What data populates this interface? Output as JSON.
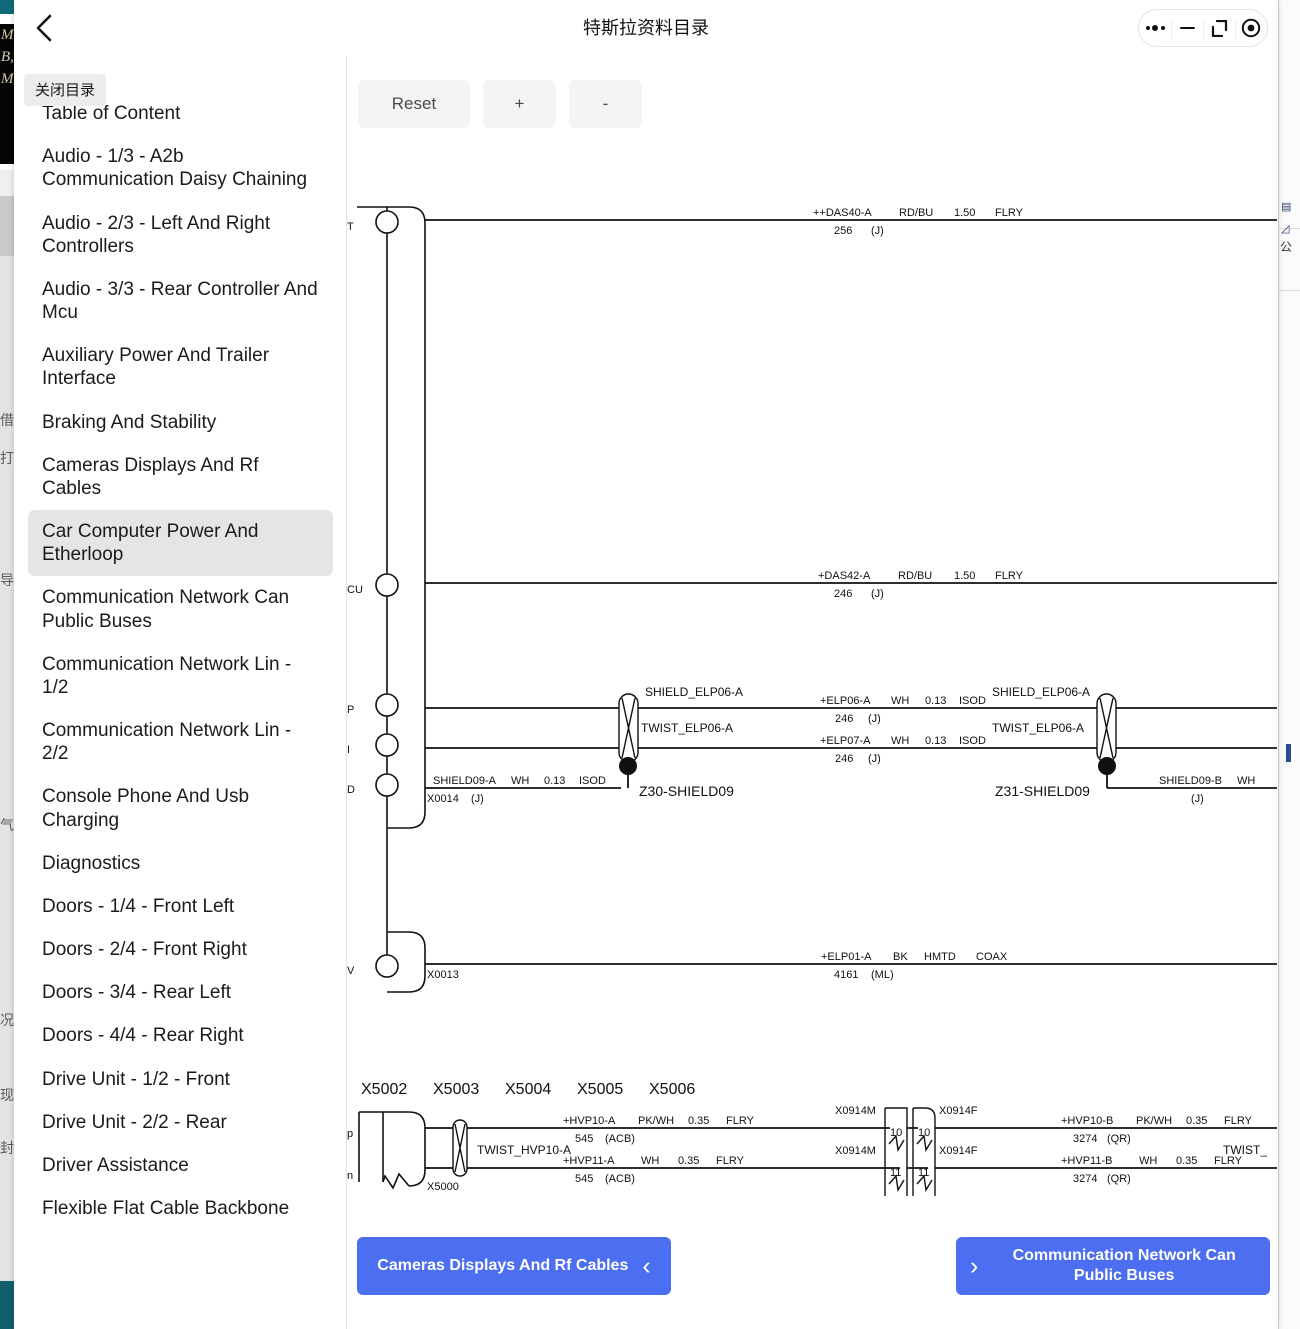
{
  "window": {
    "title": "特斯拉资料目录",
    "back_icon": "chevron-left-icon",
    "controls": [
      {
        "name": "more-options",
        "icon": "ellipsis-icon"
      },
      {
        "name": "minimize",
        "icon": "minus-icon"
      },
      {
        "name": "maximize",
        "icon": "restore-icon"
      },
      {
        "name": "close",
        "icon": "circle-dot-icon"
      }
    ]
  },
  "sidebar": {
    "tooltip": "关闭目录",
    "active_index": 8,
    "items": [
      {
        "label": "Table of Content"
      },
      {
        "label": "Audio - 1/3 - A2b Communication Daisy Chaining"
      },
      {
        "label": "Audio - 2/3 - Left And Right Controllers"
      },
      {
        "label": "Audio - 3/3 - Rear Controller And Mcu"
      },
      {
        "label": "Auxiliary Power And Trailer Interface"
      },
      {
        "label": "Braking And Stability"
      },
      {
        "label": "Cameras Displays And Rf Cables"
      },
      {
        "label": "Car Computer Power And Etherloop"
      },
      {
        "label": "Communication Network Can Public Buses"
      },
      {
        "label": "Communication Network Lin - 1/2"
      },
      {
        "label": "Communication Network Lin - 2/2"
      },
      {
        "label": "Console Phone And Usb Charging"
      },
      {
        "label": "Diagnostics"
      },
      {
        "label": "Doors - 1/4 - Front Left"
      },
      {
        "label": "Doors - 2/4 - Front Right"
      },
      {
        "label": "Doors - 3/4 - Rear Left"
      },
      {
        "label": "Doors - 4/4 - Rear Right"
      },
      {
        "label": "Drive Unit - 1/2 - Front"
      },
      {
        "label": "Drive Unit - 2/2 - Rear"
      },
      {
        "label": "Driver Assistance"
      },
      {
        "label": "Flexible Flat Cable Backbone"
      }
    ]
  },
  "toolbar": {
    "reset_label": "Reset",
    "zoom_in_label": "+",
    "zoom_out_label": "-"
  },
  "bottom_nav": {
    "prev": {
      "label": "Cameras Displays And Rf Cables",
      "chevron": "chevron-left-icon"
    },
    "next": {
      "label": "Communication Network Can Public Buses",
      "chevron": "chevron-right-icon"
    },
    "color": "#4c6ef0"
  },
  "diagram": {
    "left_pin_labels": [
      "T",
      "CU",
      "P",
      "I",
      "D",
      "V"
    ],
    "connector_refs": [
      "X0014",
      "X0013",
      "X5000"
    ],
    "top_connector_row": [
      "X5002",
      "X5003",
      "X5004",
      "X5005",
      "X5006"
    ],
    "wires": [
      {
        "id": "++DAS40-A",
        "color": "RD/BU",
        "gauge": "1.50",
        "spec": "FLRY",
        "num": "256",
        "paren": "(J)"
      },
      {
        "id": "+DAS42-A",
        "color": "RD/BU",
        "gauge": "1.50",
        "spec": "FLRY",
        "num": "246",
        "paren": "(J)"
      },
      {
        "id": "+ELP06-A",
        "color": "WH",
        "gauge": "0.13",
        "spec": "ISOD",
        "num": "246",
        "paren": "(J)"
      },
      {
        "id": "+ELP07-A",
        "color": "WH",
        "gauge": "0.13",
        "spec": "ISOD",
        "num": "246",
        "paren": "(J)"
      },
      {
        "id": "SHIELD09-A",
        "color": "WH",
        "gauge": "0.13",
        "spec": "ISOD",
        "num": "X0014",
        "paren": "(J)"
      },
      {
        "id": "SHIELD09-B",
        "color": "WH",
        "gauge": "",
        "spec": "",
        "num": "",
        "paren": "(J)"
      },
      {
        "id": "+ELP01-A",
        "color": "BK",
        "gauge": "HMTD",
        "spec": "COAX",
        "num": "4161",
        "paren": "(ML)"
      },
      {
        "id": "+HVP10-A",
        "color": "PK/WH",
        "gauge": "0.35",
        "spec": "FLRY",
        "num": "545",
        "paren": "(ACB)"
      },
      {
        "id": "+HVP11-A",
        "color": "WH",
        "gauge": "0.35",
        "spec": "FLRY",
        "num": "545",
        "paren": "(ACB)"
      },
      {
        "id": "+HVP10-B",
        "color": "PK/WH",
        "gauge": "0.35",
        "spec": "FLRY",
        "num": "3274",
        "paren": "(QR)"
      },
      {
        "id": "+HVP11-B",
        "color": "WH",
        "gauge": "0.35",
        "spec": "FLRY",
        "num": "3274",
        "paren": "(QR)"
      }
    ],
    "shield_labels": [
      "SHIELD_ELP06-A",
      "SHIELD_ELP06-A"
    ],
    "twist_labels": [
      "TWIST_ELP06-A",
      "TWIST_ELP06-A",
      "TWIST_HVP10-A",
      "TWIST_"
    ],
    "splice_labels": [
      "Z30-SHIELD09",
      "Z31-SHIELD09"
    ],
    "inline_connectors": [
      {
        "male": "X0914M",
        "female": "X0914F",
        "pin": "10"
      },
      {
        "male": "X0914M",
        "female": "X0914F",
        "pin": "11"
      }
    ]
  }
}
